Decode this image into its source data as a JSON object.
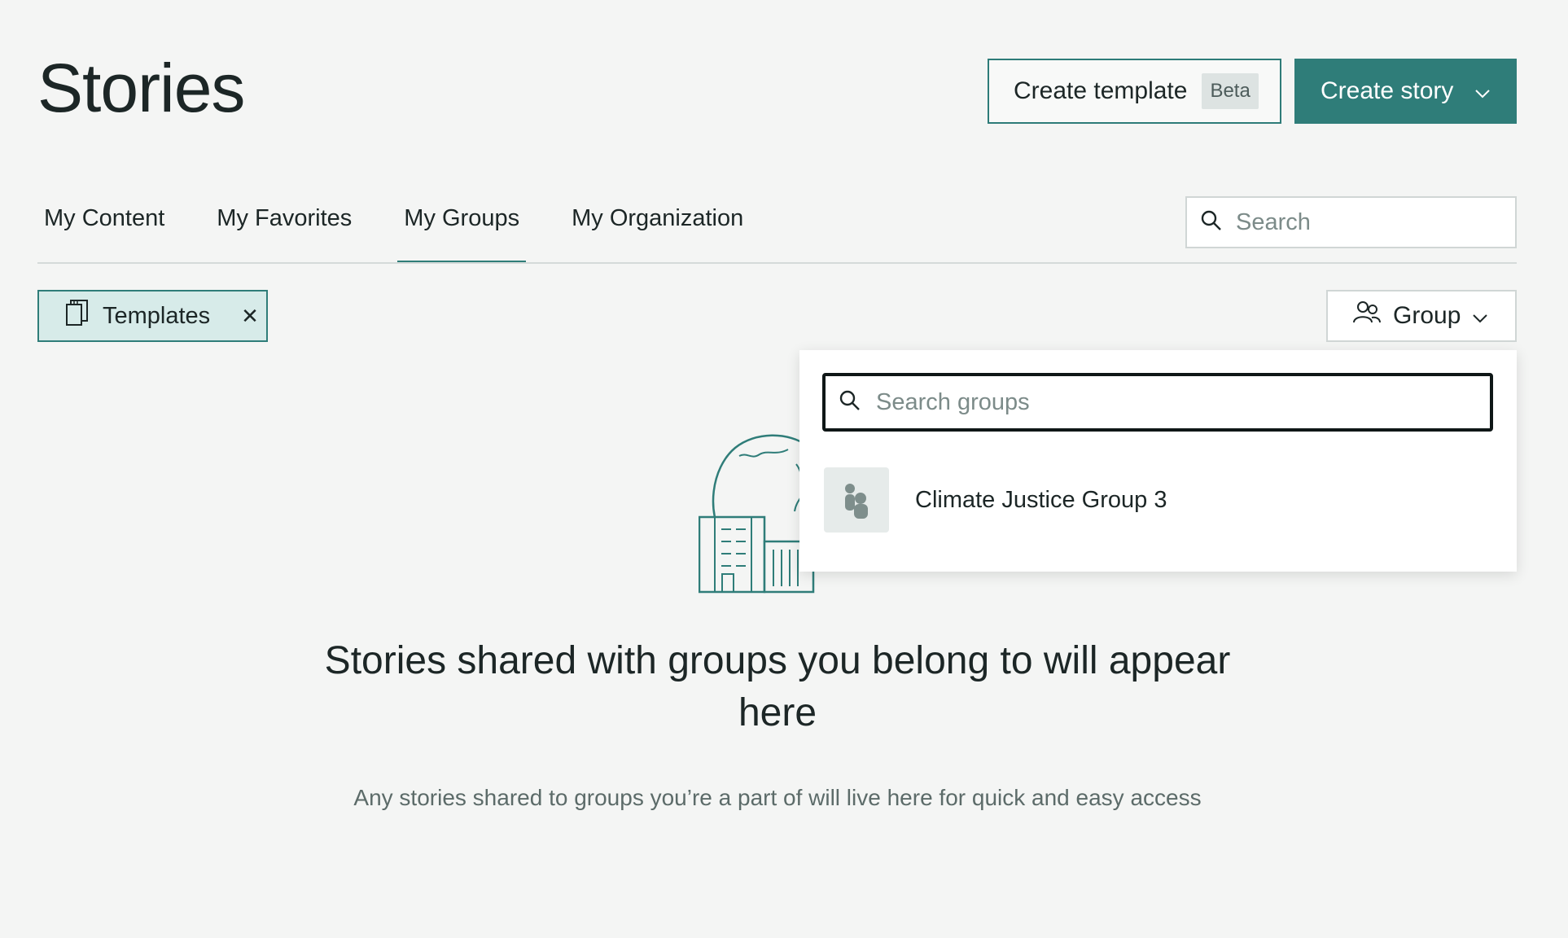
{
  "header": {
    "title": "Stories",
    "create_template_label": "Create template",
    "beta_badge": "Beta",
    "create_story_label": "Create story"
  },
  "tabs": [
    {
      "label": "My Content",
      "active": false
    },
    {
      "label": "My Favorites",
      "active": false
    },
    {
      "label": "My Groups",
      "active": true
    },
    {
      "label": "My Organization",
      "active": false
    }
  ],
  "search": {
    "placeholder": "Search",
    "value": ""
  },
  "filter_chip": {
    "label": "Templates"
  },
  "group_filter": {
    "label": "Group"
  },
  "groups_dropdown": {
    "search_placeholder": "Search groups",
    "items": [
      {
        "name": "Climate Justice Group 3"
      }
    ]
  },
  "empty_state": {
    "heading": "Stories shared with groups you belong to will appear here",
    "subtext": "Any stories shared to groups you’re a part of will live here for quick and easy access"
  },
  "colors": {
    "accent": "#2f7d79",
    "chip_bg": "#d7ebe9",
    "page_bg": "#f4f5f4"
  }
}
